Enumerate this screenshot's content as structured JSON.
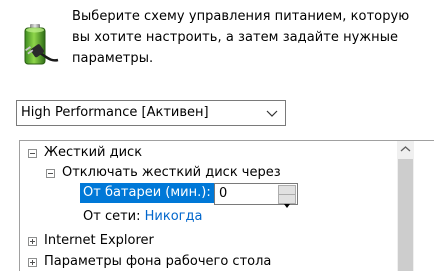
{
  "header": {
    "icon": "battery-plug-icon",
    "description_line1": "Выберите схему управления питанием, которую",
    "description_line2": "вы хотите настроить, а затем задайте нужные",
    "description_line3": "параметры."
  },
  "plan_select": {
    "selected": "High Performance [Активен]",
    "icon": "chevron-down-icon"
  },
  "tree": {
    "hard_disk": {
      "label": "Жесткий диск",
      "expanded": true
    },
    "turn_off_disk": {
      "label": "Отключать жесткий диск через",
      "expanded": true
    },
    "on_battery": {
      "label": "От батареи (мин.):",
      "value": "0"
    },
    "plugged_in": {
      "label": "От сети:",
      "value": "Никогда"
    },
    "internet_explorer": {
      "label": "Internet Explorer",
      "expanded": false
    },
    "desktop_background": {
      "label": "Параметры фона рабочего стола",
      "expanded": false
    }
  },
  "colors": {
    "selection": "#0078d7",
    "link": "#0066cc"
  }
}
